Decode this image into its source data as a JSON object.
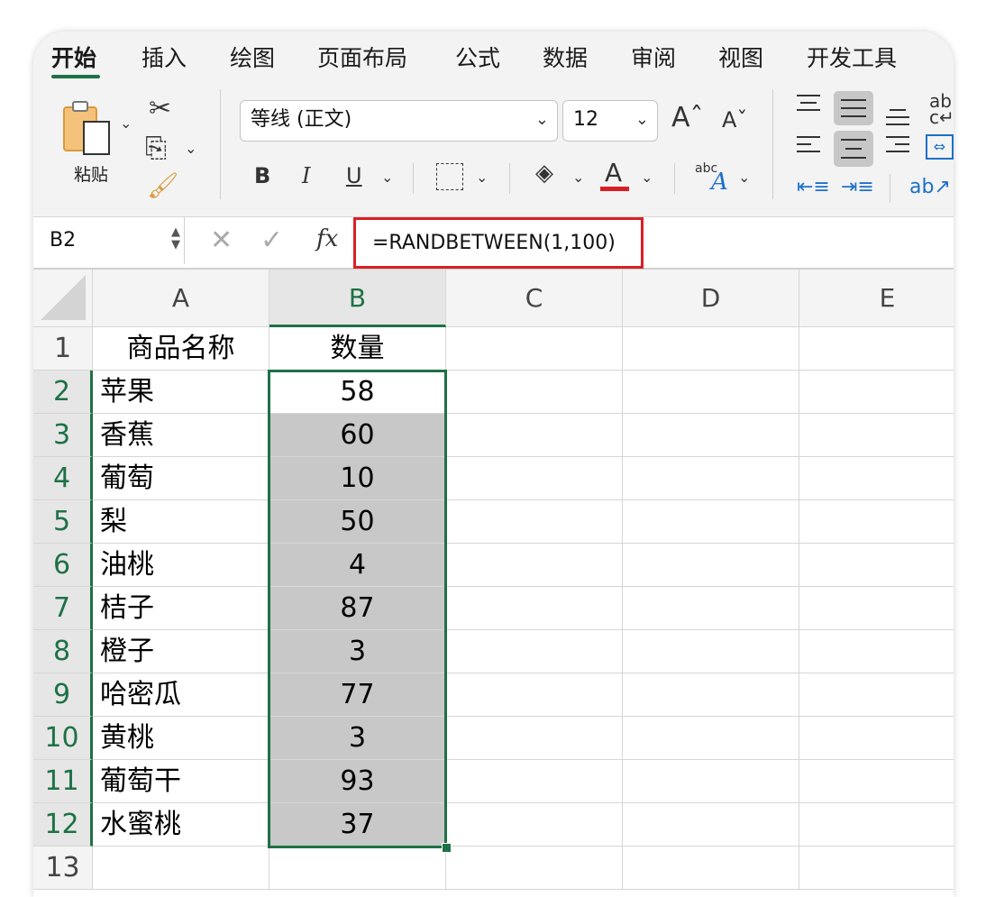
{
  "tabs": [
    "开始",
    "插入",
    "绘图",
    "页面布局",
    "公式",
    "数据",
    "审阅",
    "视图",
    "开发工具"
  ],
  "clipboard": {
    "paste_label": "粘贴"
  },
  "font": {
    "name": "等线 (正文)",
    "size": "12"
  },
  "format": {
    "bold": "B",
    "italic": "I",
    "underline": "U",
    "font_color_letter": "A",
    "font_color": "#d81f26",
    "abc": "abc"
  },
  "formula_bar": {
    "name_box": "B2",
    "fx": "fx",
    "formula": "=RANDBETWEEN(1,100)"
  },
  "columns": [
    "A",
    "B",
    "C",
    "D",
    "E"
  ],
  "rows": [
    {
      "n": "1",
      "a": "商品名称",
      "b": "数量"
    },
    {
      "n": "2",
      "a": "苹果",
      "b": "58"
    },
    {
      "n": "3",
      "a": "香蕉",
      "b": "60"
    },
    {
      "n": "4",
      "a": "葡萄",
      "b": "10"
    },
    {
      "n": "5",
      "a": "梨",
      "b": "50"
    },
    {
      "n": "6",
      "a": "油桃",
      "b": "4"
    },
    {
      "n": "7",
      "a": "桔子",
      "b": "87"
    },
    {
      "n": "8",
      "a": "橙子",
      "b": "3"
    },
    {
      "n": "9",
      "a": "哈密瓜",
      "b": "77"
    },
    {
      "n": "10",
      "a": "黄桃",
      "b": "3"
    },
    {
      "n": "11",
      "a": "葡萄干",
      "b": "93"
    },
    {
      "n": "12",
      "a": "水蜜桃",
      "b": "37"
    },
    {
      "n": "13",
      "a": "",
      "b": ""
    }
  ],
  "colors": {
    "accent": "#1e7145",
    "highlight_border": "#d81f26",
    "selection_fill": "#c8c8c8"
  }
}
